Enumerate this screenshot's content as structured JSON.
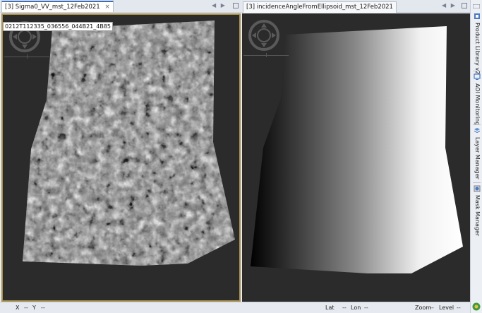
{
  "left_view": {
    "tab_title": "[3] Sigma0_VV_mst_12Feb2021",
    "close_glyph": "×",
    "overlay_label": "0212T112335_036556_044B21_4B85",
    "nav_icon": "pan-compass-icon",
    "status": {
      "x_label": "X",
      "x_value": "--",
      "y_label": "Y",
      "y_value": "--"
    }
  },
  "right_view": {
    "tab_title": "[3] incidenceAngleFromEllipsoid_mst_12Feb2021",
    "nav_icon": "pan-compass-icon",
    "status": {
      "lat_label": "Lat",
      "lat_value": "--",
      "lon_label": "Lon",
      "lon_value": "--",
      "zoom_label": "Zoom",
      "zoom_value": "--",
      "level_label": "Level",
      "level_value": "--"
    }
  },
  "nav_arrows": "◀ ▶",
  "side_tabs": [
    {
      "label": "Product Library v2",
      "icon": "library-icon"
    },
    {
      "label": "AOI Monitoring",
      "icon": "monitor-icon"
    },
    {
      "label": "Layer Manager",
      "icon": "layers-icon"
    },
    {
      "label": "Mask Manager",
      "icon": "mask-icon"
    }
  ],
  "colors": {
    "viewport_bg": "#2b2b2b",
    "active_frame": "#a89150",
    "tab_accent": "#3d6fb8"
  }
}
